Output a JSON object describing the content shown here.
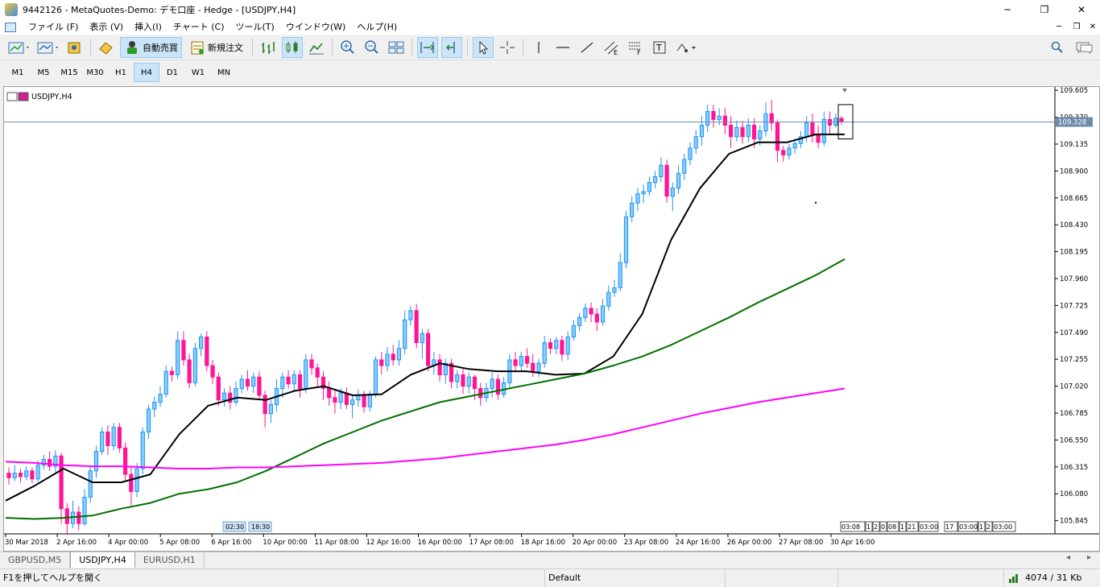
{
  "window": {
    "title": "9442126 - MetaQuotes-Demo: デモ口座 - Hedge - [USDJPY,H4]"
  },
  "menu": [
    "ファイル (F)",
    "表示 (V)",
    "挿入(I)",
    "チャート (C)",
    "ツール(T)",
    "ウインドウ(W)",
    "ヘルプ(H)"
  ],
  "toolbar": {
    "autotrade_label": "自動売買",
    "neworder_label": "新規注文"
  },
  "timeframes": [
    "M1",
    "M5",
    "M15",
    "M30",
    "H1",
    "H4",
    "D1",
    "W1",
    "MN"
  ],
  "active_timeframe": "H4",
  "chart": {
    "label": "USDJPY,H4",
    "current_price": "109.328",
    "session_labels": [
      "02:30",
      "18:30"
    ],
    "x_tick_labels": [
      "30 Mar 2018",
      "2 Apr 16:00",
      "4 Apr 00:00",
      "5 Apr 08:00",
      "6 Apr 16:00",
      "10 Apr 00:00",
      "11 Apr 08:00",
      "12 Apr 16:00",
      "16 Apr 00:00",
      "17 Apr 08:00",
      "18 Apr 16:00",
      "20 Apr 00:00",
      "23 Apr 08:00",
      "24 Apr 16:00",
      "26 Apr 00:00",
      "27 Apr 08:00",
      "30 Apr 16:00"
    ],
    "right_box_labels": [
      "03:08",
      "1",
      "2",
      "0",
      "08",
      "1",
      "21",
      "03:00",
      "17",
      "03:00",
      "1",
      "2",
      "03:00"
    ],
    "colors": {
      "bull": "#1e90ff",
      "bull_fill": "#87cefa",
      "bear": "#ff1493",
      "ma_fast": "#000000",
      "ma_mid": "#007000",
      "ma_slow": "#ff00ff",
      "grid_line": "#6e8caa"
    }
  },
  "chart_data": {
    "type": "candlestick",
    "symbol": "USDJPY",
    "timeframe": "H4",
    "ylim": [
      105.73,
      109.62
    ],
    "y_tick_labels": [
      "109.605",
      "109.370",
      "109.135",
      "108.900",
      "108.665",
      "108.430",
      "108.195",
      "107.960",
      "107.725",
      "107.490",
      "107.255",
      "107.020",
      "106.785",
      "106.550",
      "106.315",
      "106.080",
      "105.845"
    ],
    "y_ticks": [
      109.605,
      109.37,
      109.135,
      108.9,
      108.665,
      108.43,
      108.195,
      107.96,
      107.725,
      107.49,
      107.255,
      107.02,
      106.785,
      106.55,
      106.315,
      106.08,
      105.845
    ],
    "current_price": 109.328,
    "candles": [
      [
        106.26,
        106.22,
        106.31,
        106.16
      ],
      [
        106.22,
        106.26,
        106.33,
        106.19
      ],
      [
        106.26,
        106.23,
        106.3,
        106.18
      ],
      [
        106.23,
        106.28,
        106.32,
        106.2
      ],
      [
        106.28,
        106.21,
        106.31,
        106.17
      ],
      [
        106.21,
        106.33,
        106.37,
        106.18
      ],
      [
        106.33,
        106.38,
        106.42,
        106.29
      ],
      [
        106.38,
        106.32,
        106.45,
        106.28
      ],
      [
        106.32,
        106.41,
        106.46,
        106.27
      ],
      [
        106.41,
        105.95,
        106.44,
        105.82
      ],
      [
        105.95,
        105.82,
        106.0,
        105.72
      ],
      [
        105.82,
        105.92,
        106.02,
        105.78
      ],
      [
        105.92,
        105.82,
        105.97,
        105.76
      ],
      [
        105.82,
        106.05,
        106.12,
        105.8
      ],
      [
        106.05,
        106.28,
        106.32,
        106.0
      ],
      [
        106.28,
        106.45,
        106.5,
        106.22
      ],
      [
        106.45,
        106.62,
        106.66,
        106.42
      ],
      [
        106.62,
        106.5,
        106.68,
        106.42
      ],
      [
        106.5,
        106.66,
        106.7,
        106.46
      ],
      [
        106.66,
        106.48,
        106.7,
        106.44
      ],
      [
        106.48,
        106.25,
        106.53,
        106.2
      ],
      [
        106.25,
        106.1,
        106.32,
        105.98
      ],
      [
        106.1,
        106.3,
        106.35,
        106.05
      ],
      [
        106.3,
        106.62,
        106.66,
        106.25
      ],
      [
        106.62,
        106.82,
        106.86,
        106.56
      ],
      [
        106.82,
        106.88,
        106.93,
        106.75
      ],
      [
        106.88,
        106.95,
        107.02,
        106.84
      ],
      [
        106.95,
        107.15,
        107.2,
        106.92
      ],
      [
        107.15,
        107.12,
        107.19,
        107.06
      ],
      [
        107.12,
        107.42,
        107.5,
        107.08
      ],
      [
        107.42,
        107.25,
        107.5,
        107.2
      ],
      [
        107.25,
        107.05,
        107.3,
        107.0
      ],
      [
        107.05,
        107.35,
        107.4,
        107.02
      ],
      [
        107.35,
        107.45,
        107.48,
        107.28
      ],
      [
        107.45,
        107.2,
        107.5,
        107.15
      ],
      [
        107.2,
        107.1,
        107.25,
        107.04
      ],
      [
        107.1,
        106.9,
        107.14,
        106.85
      ],
      [
        106.9,
        106.96,
        107.0,
        106.84
      ],
      [
        106.96,
        106.88,
        107.02,
        106.82
      ],
      [
        106.88,
        107.0,
        107.06,
        106.85
      ],
      [
        107.0,
        107.08,
        107.12,
        106.96
      ],
      [
        107.08,
        107.02,
        107.16,
        106.98
      ],
      [
        107.02,
        107.1,
        107.14,
        106.96
      ],
      [
        107.1,
        106.94,
        107.15,
        106.9
      ],
      [
        106.94,
        106.78,
        106.98,
        106.66
      ],
      [
        106.78,
        106.86,
        106.9,
        106.7
      ],
      [
        106.86,
        107.0,
        107.08,
        106.8
      ],
      [
        107.0,
        107.1,
        107.14,
        106.92
      ],
      [
        107.1,
        107.04,
        107.16,
        107.0
      ],
      [
        107.04,
        107.12,
        107.16,
        106.98
      ],
      [
        107.12,
        107.0,
        107.16,
        106.92
      ],
      [
        107.0,
        107.25,
        107.3,
        106.96
      ],
      [
        107.25,
        107.18,
        107.3,
        107.12
      ],
      [
        107.18,
        107.1,
        107.22,
        107.02
      ],
      [
        107.1,
        107.0,
        107.15,
        106.9
      ],
      [
        107.0,
        106.92,
        107.06,
        106.85
      ],
      [
        106.92,
        106.88,
        106.98,
        106.78
      ],
      [
        106.88,
        106.96,
        107.0,
        106.82
      ],
      [
        106.96,
        106.86,
        107.01,
        106.82
      ],
      [
        106.86,
        106.9,
        106.95,
        106.74
      ],
      [
        106.9,
        106.94,
        106.99,
        106.84
      ],
      [
        106.94,
        106.84,
        106.98,
        106.79
      ],
      [
        106.84,
        106.95,
        106.98,
        106.8
      ],
      [
        106.95,
        107.25,
        107.28,
        106.92
      ],
      [
        107.25,
        107.2,
        107.32,
        107.12
      ],
      [
        107.2,
        107.3,
        107.36,
        107.15
      ],
      [
        107.3,
        107.25,
        107.38,
        107.2
      ],
      [
        107.25,
        107.35,
        107.42,
        107.2
      ],
      [
        107.35,
        107.6,
        107.68,
        107.3
      ],
      [
        107.6,
        107.68,
        107.72,
        107.55
      ],
      [
        107.68,
        107.4,
        107.74,
        107.35
      ],
      [
        107.4,
        107.48,
        107.52,
        107.26
      ],
      [
        107.48,
        107.2,
        107.52,
        107.15
      ],
      [
        107.2,
        107.25,
        107.32,
        107.12
      ],
      [
        107.25,
        107.12,
        107.3,
        107.06
      ],
      [
        107.12,
        107.22,
        107.26,
        107.04
      ],
      [
        107.22,
        107.06,
        107.26,
        107.0
      ],
      [
        107.06,
        107.12,
        107.16,
        107.0
      ],
      [
        107.12,
        107.02,
        107.18,
        106.95
      ],
      [
        107.02,
        107.1,
        107.14,
        106.96
      ],
      [
        107.1,
        107.0,
        107.12,
        106.9
      ],
      [
        107.0,
        106.92,
        107.05,
        106.85
      ],
      [
        106.92,
        107.0,
        107.05,
        106.88
      ],
      [
        107.0,
        107.08,
        107.14,
        106.92
      ],
      [
        107.08,
        106.95,
        107.12,
        106.9
      ],
      [
        106.95,
        107.05,
        107.1,
        106.92
      ],
      [
        107.05,
        107.25,
        107.3,
        107.0
      ],
      [
        107.25,
        107.2,
        107.32,
        107.15
      ],
      [
        107.2,
        107.28,
        107.32,
        107.15
      ],
      [
        107.28,
        107.22,
        107.35,
        107.18
      ],
      [
        107.22,
        107.15,
        107.3,
        107.1
      ],
      [
        107.15,
        107.22,
        107.26,
        107.1
      ],
      [
        107.22,
        107.4,
        107.46,
        107.18
      ],
      [
        107.4,
        107.35,
        107.44,
        107.3
      ],
      [
        107.35,
        107.42,
        107.45,
        107.3
      ],
      [
        107.42,
        107.3,
        107.46,
        107.24
      ],
      [
        107.3,
        107.45,
        107.5,
        107.25
      ],
      [
        107.45,
        107.55,
        107.6,
        107.42
      ],
      [
        107.55,
        107.62,
        107.66,
        107.5
      ],
      [
        107.62,
        107.7,
        107.74,
        107.58
      ],
      [
        107.7,
        107.65,
        107.75,
        107.58
      ],
      [
        107.65,
        107.58,
        107.7,
        107.5
      ],
      [
        107.58,
        107.72,
        107.78,
        107.55
      ],
      [
        107.72,
        107.84,
        107.9,
        107.68
      ],
      [
        107.84,
        107.88,
        107.95,
        107.8
      ],
      [
        107.88,
        108.1,
        108.18,
        107.85
      ],
      [
        108.1,
        108.5,
        108.55,
        108.05
      ],
      [
        108.5,
        108.62,
        108.68,
        108.45
      ],
      [
        108.62,
        108.7,
        108.75,
        108.55
      ],
      [
        108.7,
        108.72,
        108.78,
        108.62
      ],
      [
        108.72,
        108.8,
        108.85,
        108.68
      ],
      [
        108.8,
        108.85,
        108.9,
        108.75
      ],
      [
        108.85,
        108.95,
        109.02,
        108.8
      ],
      [
        108.95,
        108.68,
        109.0,
        108.62
      ],
      [
        108.68,
        108.75,
        108.8,
        108.55
      ],
      [
        108.75,
        108.88,
        108.95,
        108.7
      ],
      [
        108.88,
        109.0,
        109.05,
        108.82
      ],
      [
        109.0,
        109.1,
        109.15,
        108.95
      ],
      [
        109.1,
        109.2,
        109.26,
        109.05
      ],
      [
        109.2,
        109.3,
        109.38,
        109.12
      ],
      [
        109.3,
        109.42,
        109.48,
        109.24
      ],
      [
        109.42,
        109.35,
        109.48,
        109.28
      ],
      [
        109.35,
        109.38,
        109.45,
        109.3
      ],
      [
        109.38,
        109.3,
        109.45,
        109.22
      ],
      [
        109.3,
        109.2,
        109.38,
        109.1
      ],
      [
        109.2,
        109.28,
        109.34,
        109.16
      ],
      [
        109.28,
        109.2,
        109.34,
        109.14
      ],
      [
        109.2,
        109.3,
        109.36,
        109.15
      ],
      [
        109.3,
        109.18,
        109.36,
        109.1
      ],
      [
        109.18,
        109.25,
        109.3,
        109.12
      ],
      [
        109.25,
        109.4,
        109.5,
        109.2
      ],
      [
        109.4,
        109.32,
        109.52,
        109.25
      ],
      [
        109.32,
        109.08,
        109.35,
        108.98
      ],
      [
        109.08,
        109.04,
        109.12,
        108.98
      ],
      [
        109.04,
        109.1,
        109.14,
        109.0
      ],
      [
        109.1,
        109.14,
        109.18,
        109.05
      ],
      [
        109.14,
        109.2,
        109.25,
        109.1
      ],
      [
        109.2,
        109.32,
        109.38,
        109.15
      ],
      [
        109.32,
        109.22,
        109.4,
        109.15
      ],
      [
        109.22,
        109.15,
        109.3,
        109.1
      ],
      [
        109.15,
        109.35,
        109.42,
        109.12
      ],
      [
        109.35,
        109.3,
        109.42,
        109.22
      ],
      [
        109.3,
        109.36,
        109.4,
        109.28
      ],
      [
        109.36,
        109.33,
        109.38,
        109.3
      ]
    ],
    "series": [
      {
        "values": [
          106.02,
          106.15,
          106.3,
          106.18,
          106.18,
          106.25,
          106.6,
          106.85,
          106.92,
          106.9,
          106.98,
          107.02,
          106.94,
          106.95,
          107.12,
          107.22,
          107.17,
          107.15,
          107.15,
          107.12,
          107.13,
          107.28,
          107.65,
          108.3,
          108.75,
          109.05,
          109.15,
          109.15,
          109.22,
          109.22
        ]
      },
      {
        "values": [
          105.87,
          105.86,
          105.87,
          105.89,
          105.95,
          106.0,
          106.08,
          106.12,
          106.18,
          106.28,
          106.4,
          106.52,
          106.62,
          106.72,
          106.8,
          106.88,
          106.93,
          106.98,
          107.03,
          107.08,
          107.13,
          107.2,
          107.28,
          107.38,
          107.5,
          107.62,
          107.75,
          107.87,
          107.99,
          108.13
        ]
      },
      {
        "values": [
          106.36,
          106.35,
          106.33,
          106.32,
          106.32,
          106.31,
          106.3,
          106.3,
          106.31,
          106.31,
          106.32,
          106.33,
          106.34,
          106.35,
          106.37,
          106.39,
          106.42,
          106.45,
          106.48,
          106.51,
          106.55,
          106.6,
          106.66,
          106.72,
          106.78,
          106.83,
          106.88,
          106.92,
          106.96,
          107.0
        ]
      }
    ]
  },
  "tabs": [
    "GBPUSD,M5",
    "USDJPY,H4",
    "EURUSD,H1"
  ],
  "active_tab": "USDJPY,H4",
  "status": {
    "help": "F1を押してヘルプを開く",
    "profile": "Default",
    "traffic": "4074 / 31 Kb"
  }
}
